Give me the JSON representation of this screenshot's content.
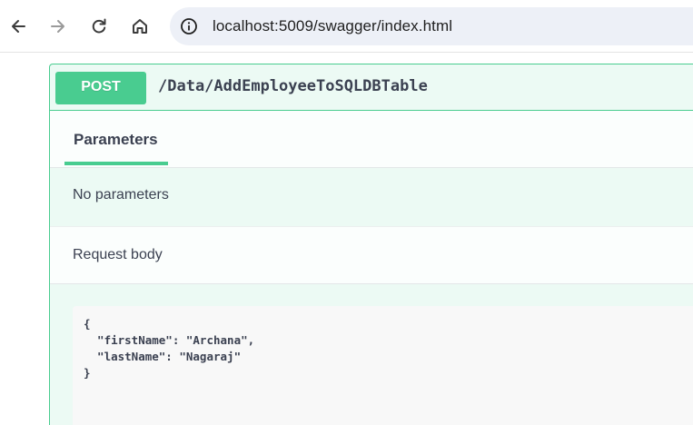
{
  "browser": {
    "url": "localhost:5009/swagger/index.html",
    "icons": [
      "back-icon",
      "forward-icon",
      "reload-icon",
      "home-icon",
      "site-info-icon"
    ]
  },
  "operation": {
    "method": "POST",
    "path": "/Data/AddEmployeeToSQLDBTable",
    "method_color": "#49cc90"
  },
  "tabs": {
    "parameters_label": "Parameters"
  },
  "parameters": {
    "empty_text": "No parameters"
  },
  "request_body": {
    "label": "Request body",
    "example": "{\n  \"firstName\": \"Archana\",\n  \"lastName\": \"Nagaraj\"\n}"
  }
}
